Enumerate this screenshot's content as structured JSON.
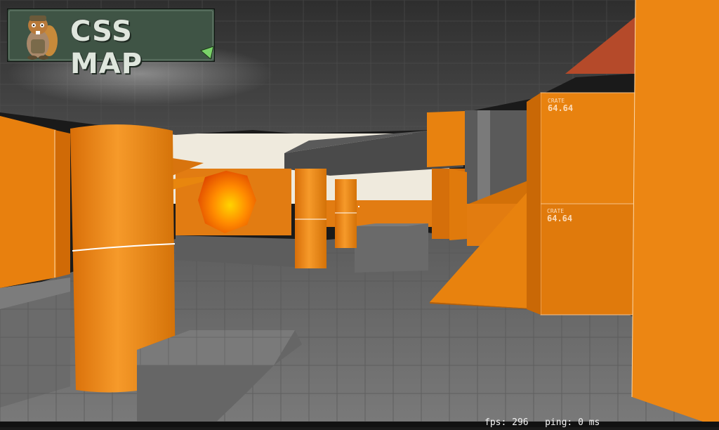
{
  "logo": {
    "text": "CSS MAP",
    "icon": "beaver-mascot-icon"
  },
  "crates": [
    {
      "label": "CRATE",
      "size": "64.64"
    },
    {
      "label": "CRATE",
      "size": "64.64"
    }
  ],
  "hud": {
    "fps_label": "fps:",
    "fps_value": "296",
    "ping_label": "ping:",
    "ping_value": "0 ms"
  },
  "colors": {
    "orange": "#e07a10",
    "orange_light": "#f28f22",
    "orange_dark": "#b85e08",
    "floor": "#6b6b6b",
    "ceiling": "#3a3a3a",
    "skybox": "#f0ece0"
  }
}
